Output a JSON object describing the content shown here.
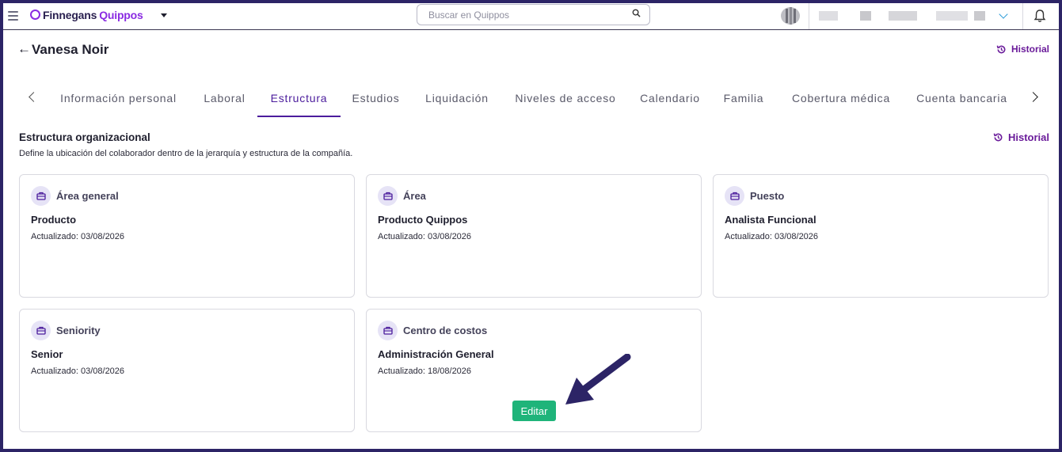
{
  "topbar": {
    "logo_text": "Finnegans",
    "logo_brand": "Quippos",
    "search_placeholder": "Buscar en Quippos",
    "icons": [
      "menu-icon",
      "caret-down-icon",
      "search-icon",
      "organization-logo",
      "chevron-down-icon",
      "bell-icon"
    ]
  },
  "header": {
    "title": "Vanesa Noir",
    "back_label": "←",
    "history_label": "Historial"
  },
  "tabs": [
    {
      "label": "Información personal",
      "active": false
    },
    {
      "label": "Laboral",
      "active": false
    },
    {
      "label": "Estructura",
      "active": true
    },
    {
      "label": "Estudios",
      "active": false
    },
    {
      "label": "Liquidación",
      "active": false
    },
    {
      "label": "Niveles de acceso",
      "active": false
    },
    {
      "label": "Calendario",
      "active": false
    },
    {
      "label": "Familia",
      "active": false
    },
    {
      "label": "Cobertura médica",
      "active": false
    },
    {
      "label": "Cuenta bancaria",
      "active": false
    }
  ],
  "section": {
    "title": "Estructura organizacional",
    "description": "Define la ubicación del colaborador dentro de la jerarquía y estructura de la compañía.",
    "history_label": "Historial"
  },
  "cards": [
    {
      "label": "Área general",
      "value": "Producto",
      "updated": "Actualizado: 03/08/2026"
    },
    {
      "label": "Área",
      "value": "Producto Quippos",
      "updated": "Actualizado: 03/08/2026"
    },
    {
      "label": "Puesto",
      "value": "Analista Funcional",
      "updated": "Actualizado: 03/08/2026"
    },
    {
      "label": "Seniority",
      "value": "Senior",
      "updated": "Actualizado: 03/08/2026"
    },
    {
      "label": "Centro de costos",
      "value": "Administración General",
      "updated": "Actualizado: 18/08/2026",
      "action_label": "Editar"
    }
  ],
  "colors": {
    "accent": "#4b1c9c",
    "history": "#6a1b9a",
    "edit_button": "#1fb47a",
    "annotation_arrow": "#2c2466"
  }
}
